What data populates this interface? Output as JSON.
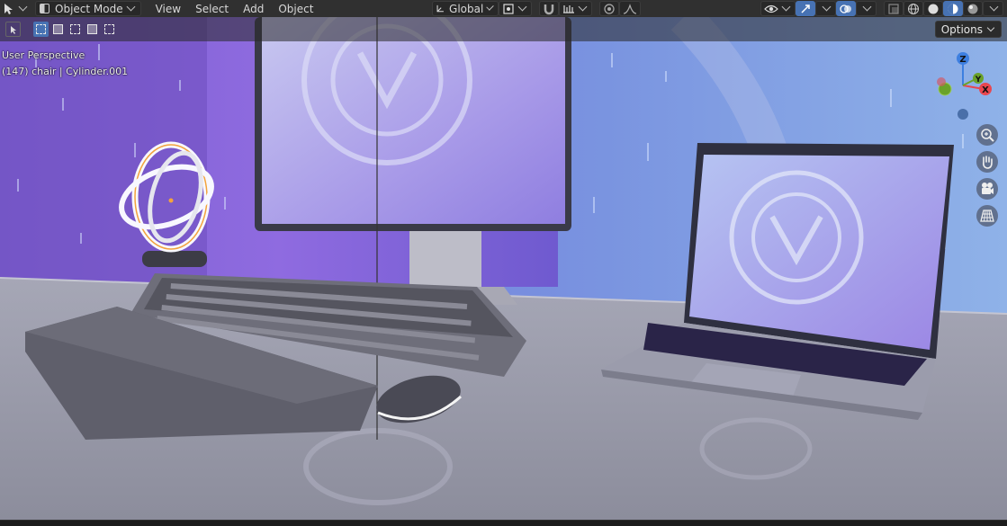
{
  "header": {
    "mode_label": "Object Mode",
    "menu": [
      "View",
      "Select",
      "Add",
      "Object"
    ],
    "transform_orientation": "Global"
  },
  "viewport": {
    "perspective_label": "User Perspective",
    "object_label": "(147) chair | Cylinder.001",
    "options_label": "Options"
  },
  "gizmo": {
    "z": "Z",
    "y": "Y",
    "x": "X"
  },
  "icons": {
    "editor_type": "cursor-icon",
    "pivot": "pivot-icon",
    "snap": "magnet-icon",
    "proportional": "proportional-icon",
    "visibility": "eye-icon",
    "gizmos": "gizmo-icon",
    "overlays": "overlay-icon",
    "xray": "xray-icon",
    "shading": [
      "wireframe-icon",
      "solid-icon",
      "material-icon",
      "rendered-icon"
    ],
    "nav": [
      "zoom-icon",
      "hand-icon",
      "camera-icon",
      "grid-icon"
    ]
  },
  "colors": {
    "accent": "#4772b3",
    "header": "#303030",
    "axis_x": "#e8464f",
    "axis_y": "#6aa22a",
    "axis_z": "#3d7fe0"
  }
}
